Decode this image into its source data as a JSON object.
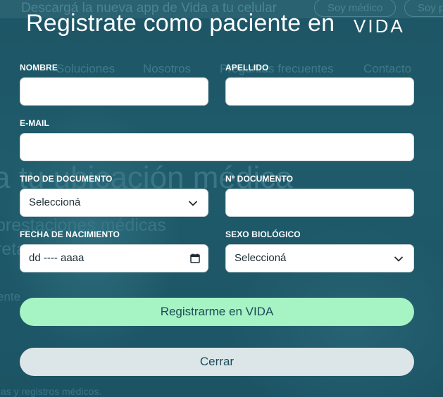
{
  "background": {
    "banner_text": "Descargá la nueva app de Vida a tu celular",
    "banner_buttons": [
      "Soy médico",
      "Soy p"
    ],
    "nav": [
      "Soluciones",
      "Nosotros",
      "Preguntas frecuentes",
      "Contacto"
    ],
    "hero": "a tu ubicación médica",
    "sub1": "prestaciones médicas",
    "sub2": "reta",
    "sub3": "ente",
    "footer": "cas y registros médicos."
  },
  "modal": {
    "title": "Registrate como paciente en",
    "brand": "VIDA",
    "fields": {
      "nombre": {
        "label": "NOMBRE",
        "value": ""
      },
      "apellido": {
        "label": "APELLIDO",
        "value": ""
      },
      "email": {
        "label": "E-MAIL",
        "value": ""
      },
      "tipo_documento": {
        "label": "TIPO DE DOCUMENTO",
        "selected": "Seleccioná"
      },
      "nro_documento": {
        "label": "Nº DOCUMENTO",
        "value": ""
      },
      "fecha_nacimiento": {
        "label": "FECHA DE NACIMIENTO",
        "placeholder": "dd ---- aaaa"
      },
      "sexo_biologico": {
        "label": "SEXO BIOLÓGICO",
        "selected": "Seleccioná"
      }
    },
    "buttons": {
      "register": "Registrarme en VIDA",
      "close": "Cerrar"
    }
  },
  "colors": {
    "overlay": "#1f5868",
    "primary_button": "#a6f3c4",
    "secondary_button": "#dce6e8",
    "button_text": "#1c4b5a"
  }
}
